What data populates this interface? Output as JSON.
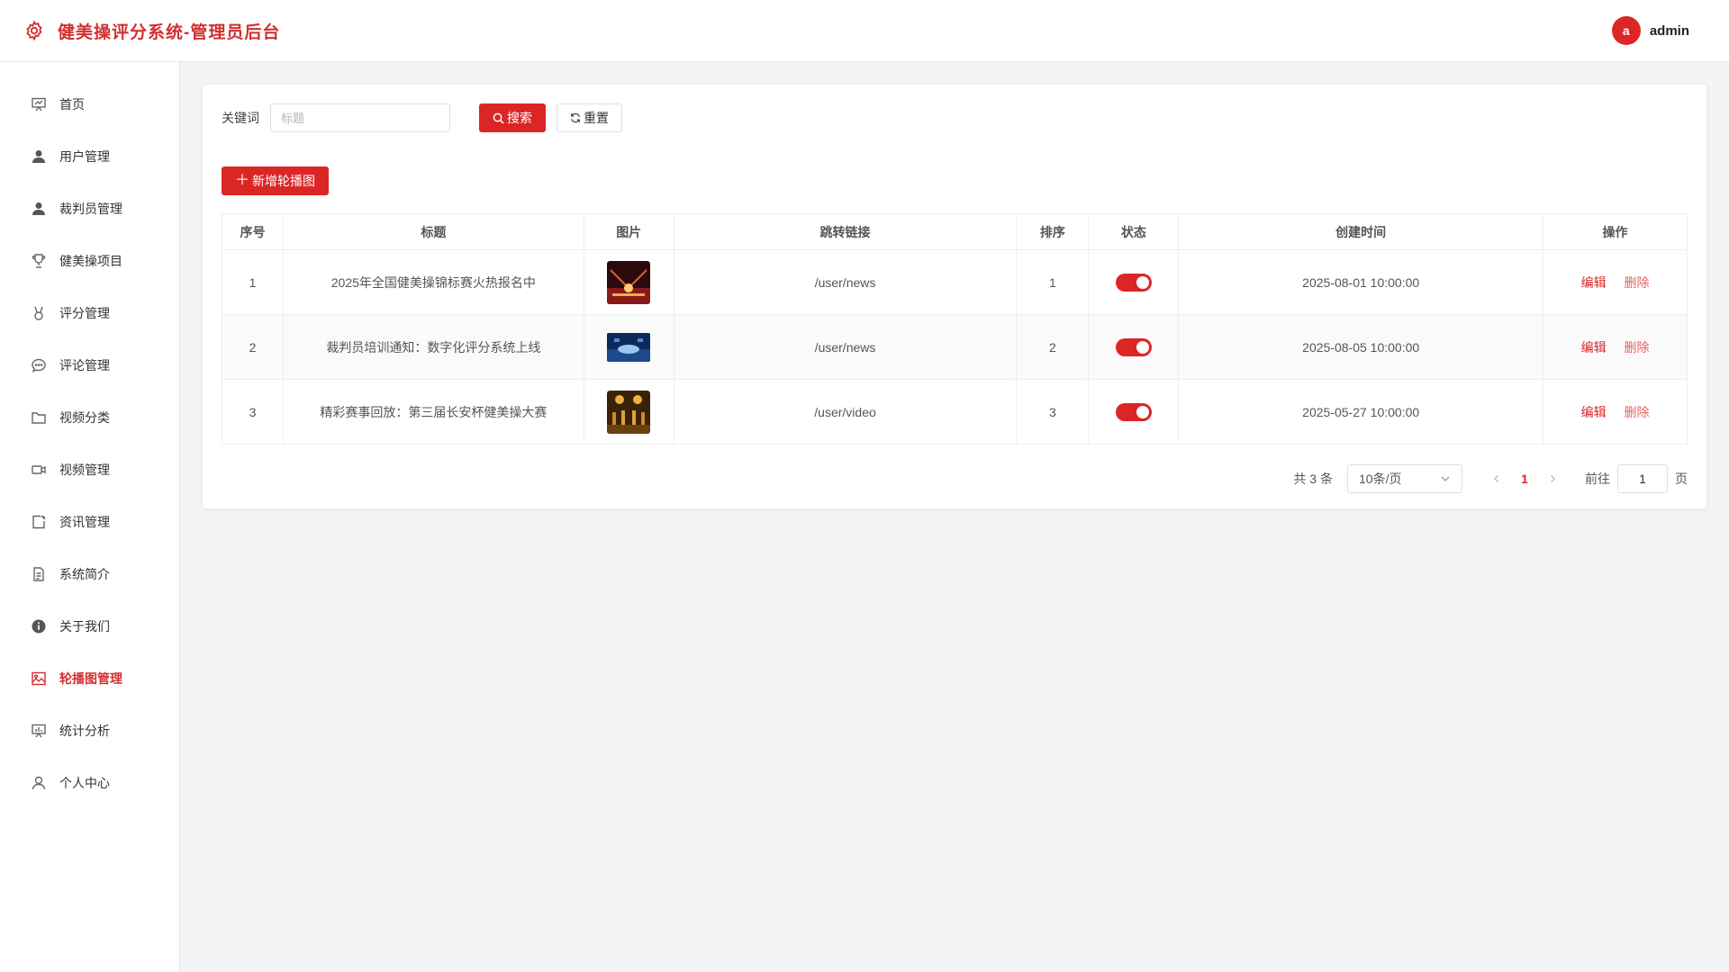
{
  "header": {
    "title": "健美操评分系统-管理员后台",
    "avatar_letter": "a",
    "username": "admin"
  },
  "sidebar": {
    "items": [
      {
        "label": "首页",
        "icon": "dashboard-icon"
      },
      {
        "label": "用户管理",
        "icon": "user-icon"
      },
      {
        "label": "裁判员管理",
        "icon": "user-icon"
      },
      {
        "label": "健美操项目",
        "icon": "trophy-icon"
      },
      {
        "label": "评分管理",
        "icon": "medal-icon"
      },
      {
        "label": "评论管理",
        "icon": "comment-icon"
      },
      {
        "label": "视频分类",
        "icon": "folder-icon"
      },
      {
        "label": "视频管理",
        "icon": "video-camera-icon"
      },
      {
        "label": "资讯管理",
        "icon": "news-icon"
      },
      {
        "label": "系统简介",
        "icon": "document-icon"
      },
      {
        "label": "关于我们",
        "icon": "info-icon"
      },
      {
        "label": "轮播图管理",
        "icon": "picture-icon"
      },
      {
        "label": "统计分析",
        "icon": "chart-icon"
      },
      {
        "label": "个人中心",
        "icon": "person-icon"
      }
    ],
    "active_label": "轮播图管理",
    "active_color": "#d32f2f"
  },
  "search": {
    "label": "关键词",
    "placeholder": "标题",
    "value": "",
    "search_button": "搜索",
    "reset_button": "重置"
  },
  "toolbar": {
    "add_button": "新增轮播图"
  },
  "table": {
    "columns": [
      "序号",
      "标题",
      "图片",
      "跳转链接",
      "排序",
      "状态",
      "创建时间",
      "操作"
    ],
    "rows": [
      {
        "index": "1",
        "title": "2025年全国健美操锦标赛火热报名中",
        "link": "/user/news",
        "sort": "1",
        "status_on": true,
        "created": "2025-08-01 10:00:00",
        "edit": "编辑",
        "delete": "删除"
      },
      {
        "index": "2",
        "title": "裁判员培训通知：数字化评分系统上线",
        "link": "/user/news",
        "sort": "2",
        "status_on": true,
        "created": "2025-08-05 10:00:00",
        "edit": "编辑",
        "delete": "删除"
      },
      {
        "index": "3",
        "title": "精彩赛事回放：第三届长安杯健美操大赛",
        "link": "/user/video",
        "sort": "3",
        "status_on": true,
        "created": "2025-05-27 10:00:00",
        "edit": "编辑",
        "delete": "删除"
      }
    ]
  },
  "pagination": {
    "total_text": "共 3 条",
    "page_size": "10条/页",
    "current_page": "1",
    "goto_label": "前往",
    "goto_value": "1",
    "page_suffix": "页"
  },
  "colors": {
    "primary": "#dc2626"
  }
}
